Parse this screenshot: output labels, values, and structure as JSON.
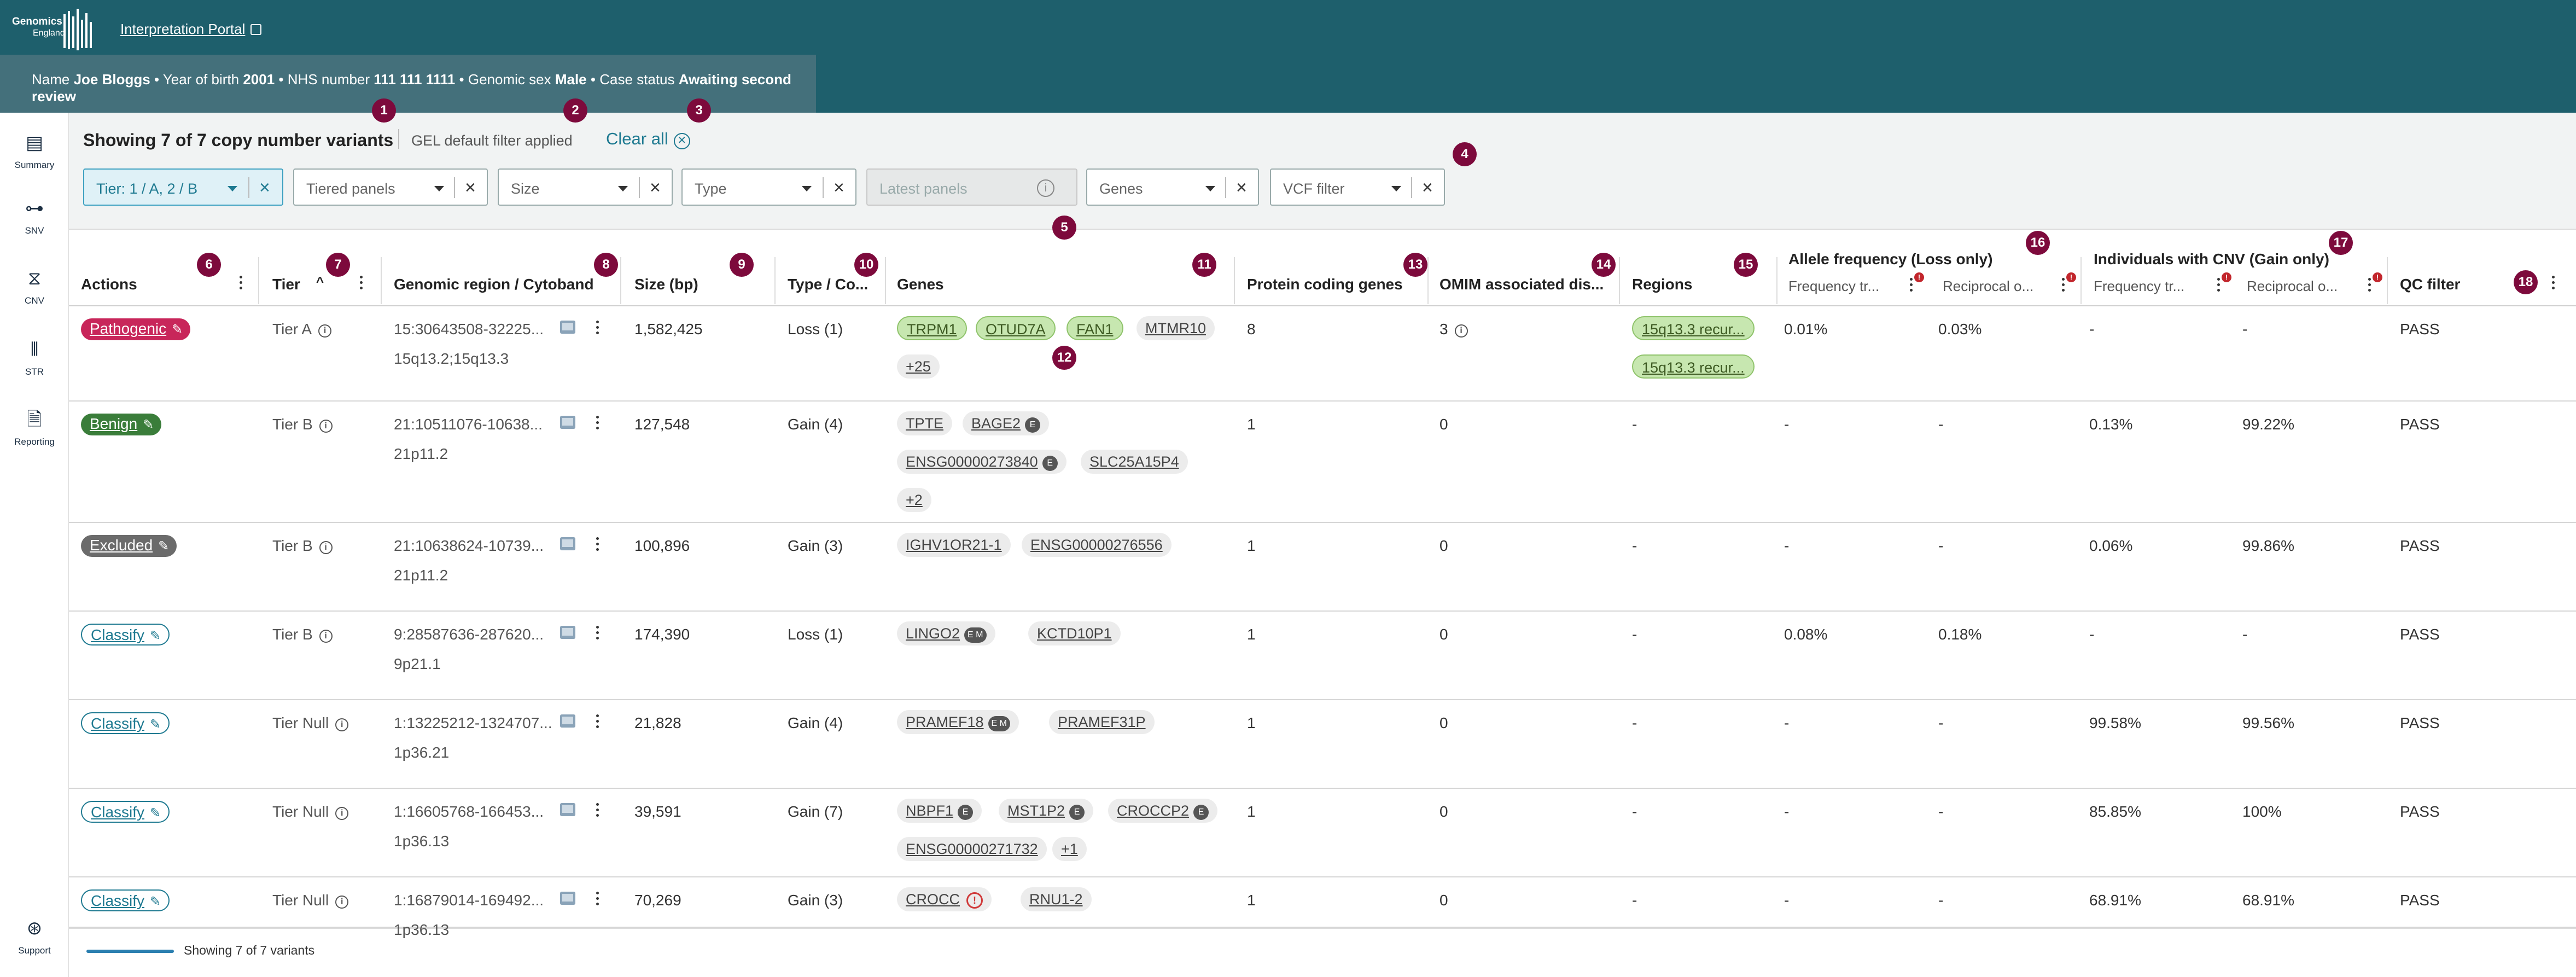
{
  "header": {
    "logo_line1": "Genomics",
    "logo_line2": "England",
    "portal_link": "Interpretation Portal",
    "patient": {
      "name_label": "Name",
      "name": "Joe Bloggs",
      "yob_label": "Year of birth",
      "yob": "2001",
      "nhs_label": "NHS number",
      "nhs": "111 111 1111",
      "sex_label": "Genomic sex",
      "sex": "Male",
      "status_label": "Case status",
      "status": "Awaiting second review",
      "sep": "•"
    }
  },
  "nav": [
    {
      "label": "Summary",
      "icon": "summary-icon"
    },
    {
      "label": "SNV",
      "icon": "snv-icon"
    },
    {
      "label": "CNV",
      "icon": "cnv-icon"
    },
    {
      "label": "STR",
      "icon": "str-icon"
    },
    {
      "label": "Reporting",
      "icon": "reporting-icon"
    },
    {
      "label": "Support",
      "icon": "support-icon"
    }
  ],
  "toolbar": {
    "title": "Showing 7 of 7 copy number variants",
    "filter_applied": "GEL default filter applied",
    "clear_all": "Clear all",
    "filters": {
      "tier": "Tier: 1 / A, 2 / B",
      "tiered_panels": "Tiered panels",
      "size": "Size",
      "type": "Type",
      "latest_panels": "Latest panels",
      "genes": "Genes",
      "vcf": "VCF filter"
    }
  },
  "badges": [
    "1",
    "2",
    "3",
    "4",
    "5",
    "6",
    "7",
    "8",
    "9",
    "10",
    "11",
    "12",
    "13",
    "14",
    "15",
    "16",
    "17",
    "18"
  ],
  "columns": {
    "actions": "Actions",
    "tier": "Tier",
    "region": "Genomic region / Cytoband",
    "size": "Size (bp)",
    "type": "Type / Co...",
    "genes": "Genes",
    "protein": "Protein coding genes",
    "omim": "OMIM associated dis...",
    "regions": "Regions",
    "af_group": "Allele frequency (Loss only)",
    "af_freq": "Frequency tr...",
    "af_recip": "Reciprocal o...",
    "ind_group": "Individuals with CNV (Gain only)",
    "ind_freq": "Frequency tr...",
    "ind_recip": "Reciprocal o...",
    "qc": "QC filter",
    "red_mark": "!"
  },
  "rows": [
    {
      "action": "Pathogenic",
      "tier": "Tier A",
      "region": "15:30643508-32225...",
      "cytoband": "15q13.2;15q13.3",
      "size": "1,582,425",
      "type": "Loss (1)",
      "genes": [
        "TRPM1",
        "OTUD7A",
        "FAN1",
        "MTMR10",
        "+25"
      ],
      "protein": "8",
      "omim": "3",
      "regions": [
        "15q13.3 recur...",
        "15q13.3 recur..."
      ],
      "af_freq": "0.01%",
      "af_recip": "0.03%",
      "ind_freq": "-",
      "ind_recip": "-",
      "qc": "PASS"
    },
    {
      "action": "Benign",
      "tier": "Tier B",
      "region": "21:10511076-10638...",
      "cytoband": "21p11.2",
      "size": "127,548",
      "type": "Gain (4)",
      "genes": [
        "TPTE",
        "BAGE2",
        "ENSG00000273840",
        "SLC25A15P4",
        "+2"
      ],
      "protein": "1",
      "omim": "0",
      "regions_text": "-",
      "af_freq": "-",
      "af_recip": "-",
      "ind_freq": "0.13%",
      "ind_recip": "99.22%",
      "qc": "PASS"
    },
    {
      "action": "Excluded",
      "tier": "Tier B",
      "region": "21:10638624-10739...",
      "cytoband": "21p11.2",
      "size": "100,896",
      "type": "Gain (3)",
      "genes": [
        "IGHV1OR21-1",
        "ENSG00000276556"
      ],
      "protein": "1",
      "omim": "0",
      "regions_text": "-",
      "af_freq": "-",
      "af_recip": "-",
      "ind_freq": "0.06%",
      "ind_recip": "99.86%",
      "qc": "PASS"
    },
    {
      "action": "Classify",
      "tier": "Tier B",
      "region": "9:28587636-287620...",
      "cytoband": "9p21.1",
      "size": "174,390",
      "type": "Loss (1)",
      "genes": [
        "LINGO2",
        "KCTD10P1"
      ],
      "protein": "1",
      "omim": "0",
      "regions_text": "-",
      "af_freq": "0.08%",
      "af_recip": "0.18%",
      "ind_freq": "-",
      "ind_recip": "-",
      "qc": "PASS"
    },
    {
      "action": "Classify",
      "tier": "Tier Null",
      "region": "1:13225212-1324707...",
      "cytoband": "1p36.21",
      "size": "21,828",
      "type": "Gain (4)",
      "genes": [
        "PRAMEF18",
        "PRAMEF31P"
      ],
      "protein": "1",
      "omim": "0",
      "regions_text": "-",
      "af_freq": "-",
      "af_recip": "-",
      "ind_freq": "99.58%",
      "ind_recip": "99.56%",
      "qc": "PASS"
    },
    {
      "action": "Classify",
      "tier": "Tier Null",
      "region": "1:16605768-166453...",
      "cytoband": "1p36.13",
      "size": "39,591",
      "type": "Gain (7)",
      "genes": [
        "NBPF1",
        "MST1P2",
        "CROCCP2",
        "ENSG00000271732",
        "+1"
      ],
      "protein": "1",
      "omim": "0",
      "regions_text": "-",
      "af_freq": "-",
      "af_recip": "-",
      "ind_freq": "85.85%",
      "ind_recip": "100%",
      "qc": "PASS"
    },
    {
      "action": "Classify",
      "tier": "Tier Null",
      "region": "1:16879014-169492...",
      "cytoband": "1p36.13",
      "size": "70,269",
      "type": "Gain (3)",
      "genes": [
        "CROCC",
        "RNU1-2"
      ],
      "protein": "1",
      "omim": "0",
      "regions_text": "-",
      "af_freq": "-",
      "af_recip": "-",
      "ind_freq": "68.91%",
      "ind_recip": "68.91%",
      "qc": "PASS"
    }
  ],
  "tags": {
    "e": "E",
    "em": "E M",
    "warn": "!"
  },
  "footer": {
    "text": "Showing 7 of 7 variants"
  }
}
